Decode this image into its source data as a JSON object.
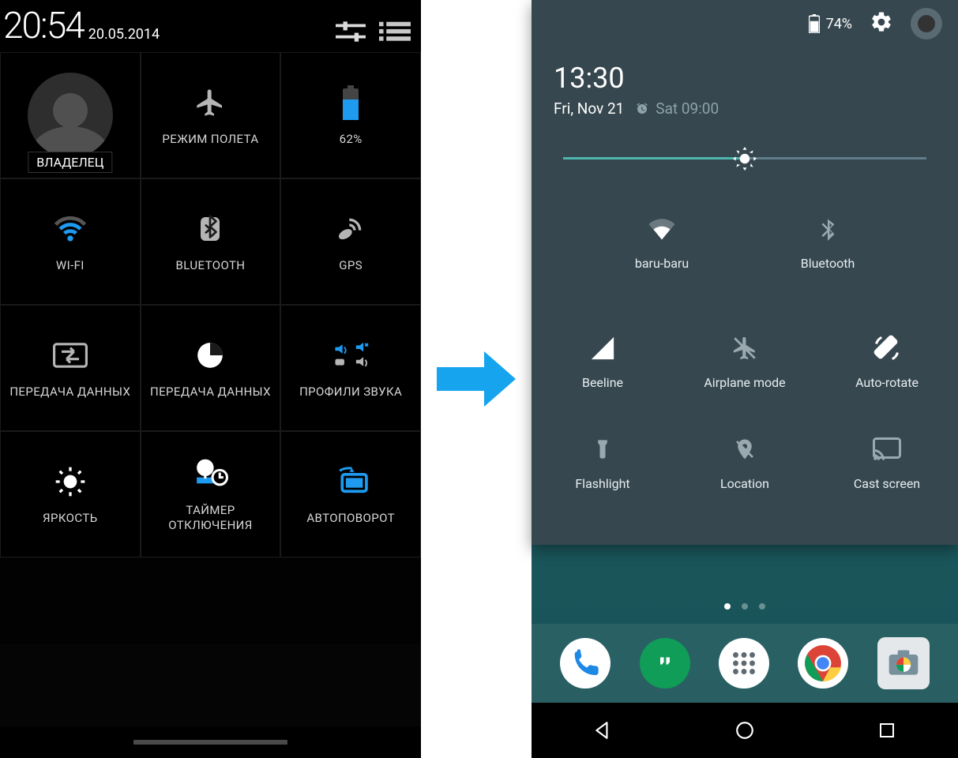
{
  "left": {
    "time": "20:54",
    "date": "20.05.2014",
    "owner": "ВЛАДЕЛЕЦ",
    "tiles": {
      "airplane": "РЕЖИМ ПОЛЕТА",
      "battery_pct": "62%",
      "wifi": "WI-FI",
      "bluetooth": "BLUETOOTH",
      "gps": "GPS",
      "data1": "ПЕРЕДАЧА ДАННЫХ",
      "data2": "ПЕРЕДАЧА ДАННЫХ",
      "sound": "ПРОФИЛИ ЗВУКА",
      "brightness": "ЯРКОСТЬ",
      "timer": "ТАЙМЕР ОТКЛЮЧЕНИЯ",
      "autorotate": "АВТОПОВОРОТ"
    }
  },
  "right": {
    "battery": "74%",
    "time": "13:30",
    "date": "Fri, Nov 21",
    "alarm": "Sat 09:00",
    "brightness_pct": 50,
    "tiles": {
      "wifi": "baru-baru",
      "bluetooth": "Bluetooth",
      "signal": "Beeline",
      "airplane": "Airplane mode",
      "autorotate": "Auto-rotate",
      "flashlight": "Flashlight",
      "location": "Location",
      "cast": "Cast screen"
    }
  },
  "colors": {
    "accent_left": "#1e9bf0",
    "accent_right": "#4db6ac",
    "panel": "#37474f"
  }
}
